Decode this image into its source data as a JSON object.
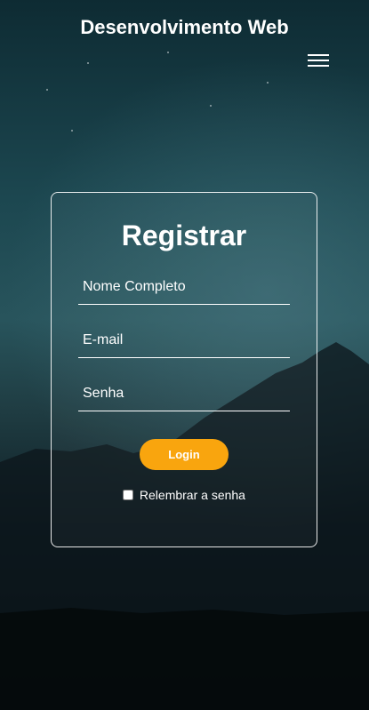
{
  "header": {
    "title": "Desenvolvimento Web",
    "menu_icon": "hamburger-menu-icon"
  },
  "form": {
    "title": "Registrar",
    "name_placeholder": "Nome Completo",
    "email_placeholder": "E-mail",
    "password_placeholder": "Senha",
    "login_label": "Login",
    "remember_label": "Relembrar a senha",
    "remember_checked": false
  },
  "colors": {
    "accent": "#f9a50e",
    "text": "#ffffff"
  }
}
